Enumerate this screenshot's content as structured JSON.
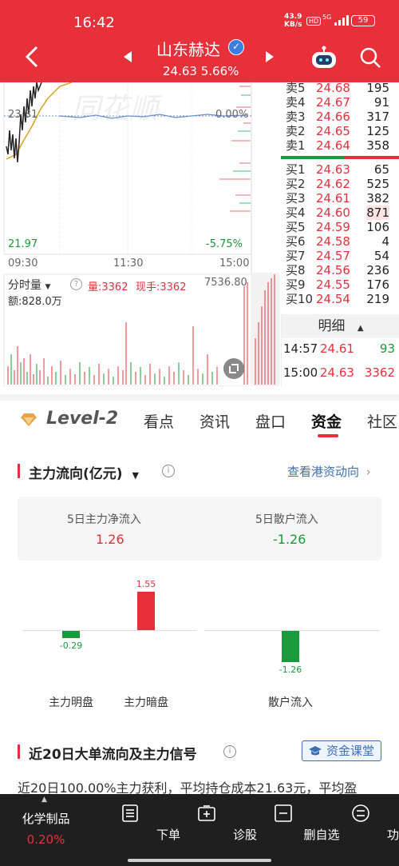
{
  "status_bar": {
    "time": "16:42",
    "net_speed_value": "43.9",
    "net_speed_unit": "KB/s",
    "hd": "HD",
    "sig": "5G",
    "battery": "59"
  },
  "header": {
    "stock_name": "山东赫达",
    "price": "24.63",
    "change_pct": "5.66%"
  },
  "chart": {
    "label_23": "23.31",
    "label_zero_pct": "0.00%",
    "label_low": "21.97",
    "label_low_pct": "-5.75%",
    "time_start": "09:30",
    "time_mid": "11:30",
    "time_end": "15:00",
    "sub_indicator": "分时量",
    "vol_label": "量:3362",
    "hand_label": "现手:3362",
    "vol_max": "7536.80",
    "amount": "额:828.0万"
  },
  "orderbook": {
    "sell": [
      {
        "label": "卖5",
        "price": "24.68",
        "vol": "195"
      },
      {
        "label": "卖4",
        "price": "24.67",
        "vol": "91"
      },
      {
        "label": "卖3",
        "price": "24.66",
        "vol": "317"
      },
      {
        "label": "卖2",
        "price": "24.65",
        "vol": "125"
      },
      {
        "label": "卖1",
        "price": "24.64",
        "vol": "358"
      }
    ],
    "buy": [
      {
        "label": "买1",
        "price": "24.63",
        "vol": "65"
      },
      {
        "label": "买2",
        "price": "24.62",
        "vol": "525"
      },
      {
        "label": "买3",
        "price": "24.61",
        "vol": "382"
      },
      {
        "label": "买4",
        "price": "24.60",
        "vol": "871"
      },
      {
        "label": "买5",
        "price": "24.59",
        "vol": "106"
      },
      {
        "label": "买6",
        "price": "24.58",
        "vol": "4"
      },
      {
        "label": "买7",
        "price": "24.57",
        "vol": "54"
      },
      {
        "label": "买8",
        "price": "24.56",
        "vol": "236"
      },
      {
        "label": "买9",
        "price": "24.55",
        "vol": "176"
      },
      {
        "label": "买10",
        "price": "24.54",
        "vol": "219"
      }
    ]
  },
  "ticks": {
    "header": "明细",
    "rows": [
      {
        "time": "14:57",
        "price": "24.61",
        "vol": "93"
      },
      {
        "time": "15:00",
        "price": "24.63",
        "vol": "3362"
      }
    ]
  },
  "tabs": {
    "level2": "Level-2",
    "items": [
      "看点",
      "资讯",
      "盘口",
      "资金",
      "社区"
    ]
  },
  "fund_flow": {
    "title": "主力流向(亿元)",
    "link": "查看港资动向",
    "net_inflow_label": "5日主力净流入",
    "net_inflow_value": "1.26",
    "retail_label": "5日散户流入",
    "retail_value": "-1.26",
    "bars": [
      {
        "label": "主力明盘",
        "value": -0.29,
        "text": "-0.29"
      },
      {
        "label": "主力暗盘",
        "value": 1.55,
        "text": "1.55"
      },
      {
        "label": "散户流入",
        "value": -1.26,
        "text": "-1.26"
      }
    ]
  },
  "big_order": {
    "title": "近20日大单流向及主力信号",
    "course_btn": "资金课堂",
    "desc": "近20日100.00%主力获利，平均持仓成本21.63元，平均盈"
  },
  "bottom_bar": {
    "sector_name": "化学制品",
    "sector_change": "0.20%",
    "items": [
      "下单",
      "诊股",
      "删自选",
      "功能"
    ]
  },
  "colors": {
    "brand_red": "#e8303b",
    "up_red": "#e8303b",
    "down_green": "#1a9a3a",
    "link_blue": "#3b6fb6"
  }
}
